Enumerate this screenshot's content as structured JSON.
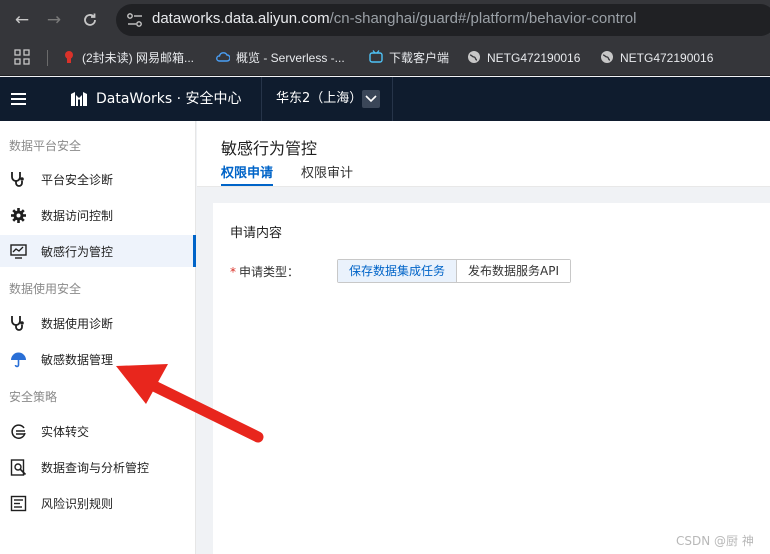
{
  "browser": {
    "url_host": "dataworks.data.aliyun.com",
    "url_path": "/cn-shanghai/guard#/platform/behavior-control",
    "nav": [
      "back",
      "forward",
      "reload"
    ],
    "bookmarks": [
      {
        "label": "(2封未读) 网易邮箱...",
        "icon": "mail-icon"
      },
      {
        "label": "概览 - Serverless -...",
        "icon": "cloud-icon"
      },
      {
        "label": "下载客户端",
        "icon": "tv-icon"
      },
      {
        "label": "NETG472190016",
        "icon": "globe-icon"
      },
      {
        "label": "NETG472190016",
        "icon": "globe-icon"
      }
    ]
  },
  "header": {
    "brand": "DataWorks · 安全中心",
    "region": "华东2（上海）"
  },
  "sidebar": {
    "sections": [
      {
        "title": "数据平台安全",
        "items": [
          {
            "label": "平台安全诊断",
            "icon": "stethoscope-icon",
            "active": false
          },
          {
            "label": "数据访问控制",
            "icon": "gear-icon",
            "active": false
          },
          {
            "label": "敏感行为管控",
            "icon": "monitor-icon",
            "active": true
          }
        ]
      },
      {
        "title": "数据使用安全",
        "items": [
          {
            "label": "数据使用诊断",
            "icon": "stethoscope-icon",
            "active": false
          },
          {
            "label": "敏感数据管理",
            "icon": "umbrella-icon",
            "active": false
          }
        ]
      },
      {
        "title": "安全策略",
        "items": [
          {
            "label": "实体转交",
            "icon": "transfer-icon",
            "active": false
          },
          {
            "label": "数据查询与分析管控",
            "icon": "search-doc-icon",
            "active": false
          },
          {
            "label": "风险识别规则",
            "icon": "list-icon",
            "active": false
          }
        ]
      }
    ]
  },
  "main": {
    "title": "敏感行为管控",
    "tabs": [
      {
        "label": "权限申请",
        "active": true
      },
      {
        "label": "权限审计",
        "active": false
      }
    ],
    "card": {
      "title": "申请内容",
      "field_required_mark": "*",
      "field_label": "申请类型：",
      "options": [
        {
          "label": "保存数据集成任务",
          "selected": true
        },
        {
          "label": "发布数据服务API",
          "selected": false
        }
      ]
    }
  },
  "watermark": "CSDN @厨 神",
  "colors": {
    "accent": "#0064c8",
    "header_bg": "#0f1c2e",
    "annotation_arrow": "#e8261d"
  }
}
